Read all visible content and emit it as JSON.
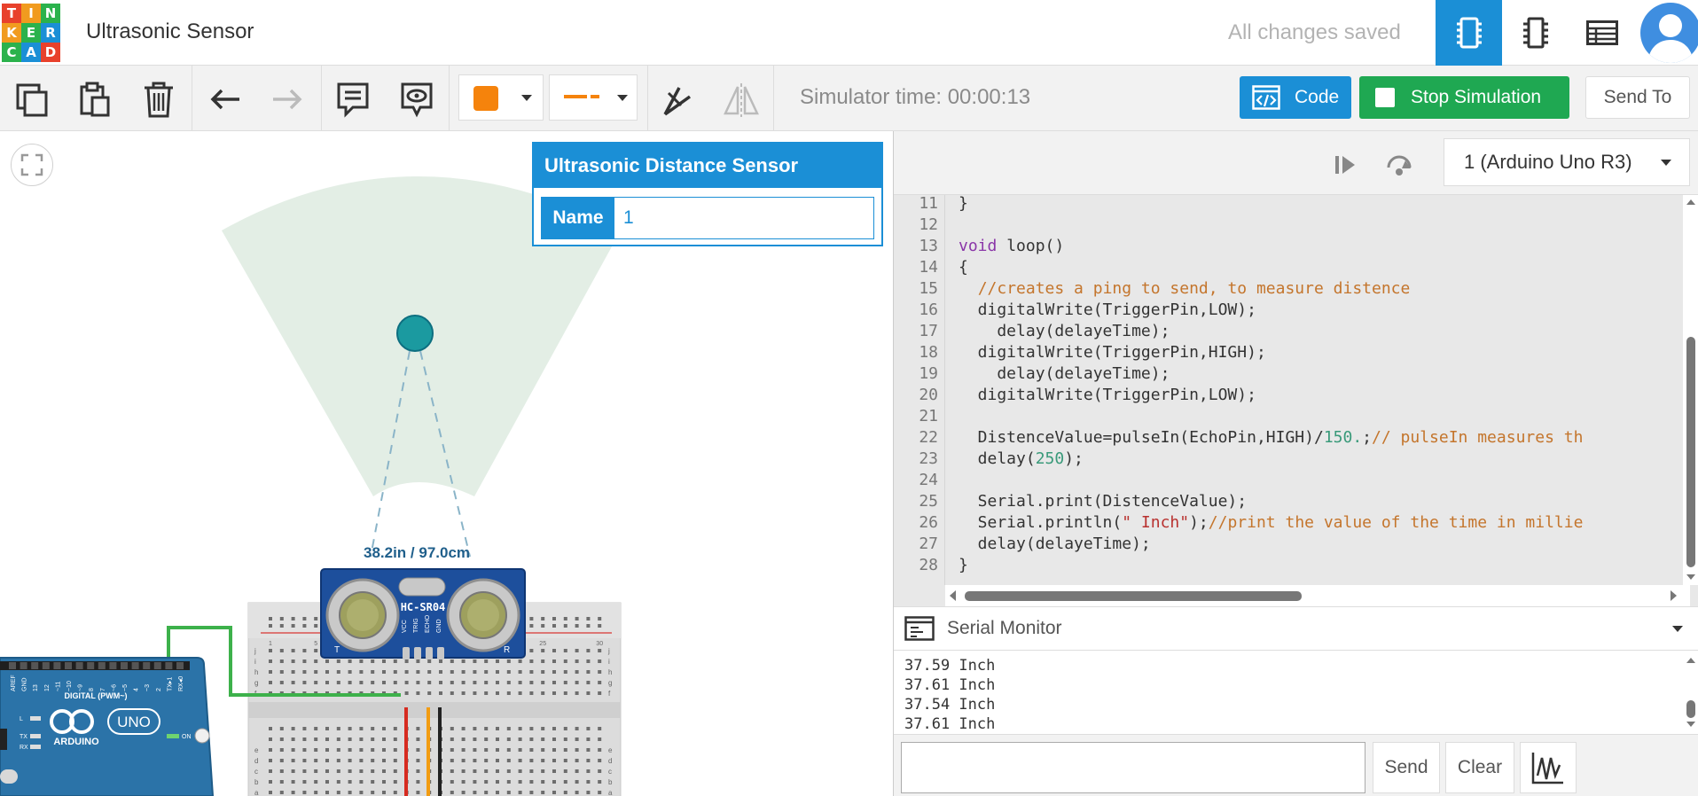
{
  "header": {
    "logo_letters": [
      "T",
      "I",
      "N",
      "K",
      "E",
      "R",
      "C",
      "A",
      "D"
    ],
    "logo_colors": [
      "#e8412c",
      "#f19b1f",
      "#2bb24c",
      "#f19b1f",
      "#2bb24c",
      "#1b8fd6",
      "#2bb24c",
      "#1b8fd6",
      "#e8412c"
    ],
    "project_title": "Ultrasonic Sensor",
    "save_status": "All changes saved",
    "views": [
      "circuit-view-icon",
      "schematic-view-icon",
      "component-list-icon"
    ],
    "active_view": "circuit-view-icon"
  },
  "toolbar": {
    "icons": [
      "copy-icon",
      "paste-icon",
      "delete-icon",
      "undo-icon",
      "redo-icon",
      "note-icon",
      "notes-visibility-icon",
      "color-picker",
      "wire-style-picker",
      "wire-tool-icon",
      "mirror-icon"
    ],
    "color_value": "#f5830c",
    "simulator_time_label": "Simulator time: 00:00:13",
    "code_label": "Code",
    "stop_label": "Stop Simulation",
    "send_to_label": "Send To"
  },
  "inspector": {
    "title": "Ultrasonic Distance Sensor",
    "name_label": "Name",
    "name_value": "1"
  },
  "canvas": {
    "distance_readout": "38.2in / 97.0cm",
    "sensor_model": "HC-SR04",
    "sensor_pins": [
      "VCC",
      "TRIG",
      "ECHO",
      "GND"
    ],
    "sensor_corner_labels": [
      "T",
      "R"
    ],
    "board_logo_text": "ARDUINO",
    "board_model": "UNO",
    "board_header_label": "DIGITAL (PWM~)",
    "board_pin_labels": [
      "AREF",
      "GND",
      "13",
      "12",
      "~11",
      "~10",
      "~9",
      "8",
      "7",
      "~6",
      "~5",
      "4",
      "~3",
      "2",
      "TX▸1",
      "RX◂0"
    ],
    "board_leds": [
      "L",
      "TX",
      "RX"
    ],
    "board_on_label": "ON",
    "breadboard_row_letters": [
      "a",
      "b",
      "c",
      "d",
      "e",
      "f",
      "g",
      "h",
      "i",
      "j"
    ],
    "breadboard_col_numbers": [
      "1",
      "5",
      "10",
      "15",
      "20",
      "25",
      "30"
    ]
  },
  "code": {
    "device": "1 (Arduino Uno R3)",
    "lines": [
      {
        "n": "11",
        "text": "}"
      },
      {
        "n": "12",
        "text": ""
      },
      {
        "n": "13",
        "kw": "void",
        "text": " loop()"
      },
      {
        "n": "14",
        "text": "{"
      },
      {
        "n": "15",
        "indent": "  ",
        "comment": "//creates a ping to send, to measure distence"
      },
      {
        "n": "16",
        "text": "  digitalWrite(TriggerPin,LOW);"
      },
      {
        "n": "17",
        "text": "    delay(delayeTime);"
      },
      {
        "n": "18",
        "text": "  digitalWrite(TriggerPin,HIGH);"
      },
      {
        "n": "19",
        "text": "    delay(delayeTime);"
      },
      {
        "n": "20",
        "text": "  digitalWrite(TriggerPin,LOW);"
      },
      {
        "n": "21",
        "text": ""
      },
      {
        "n": "22",
        "text": "  DistenceValue=pulseIn(EchoPin,HIGH)/",
        "num": "150.",
        "after": ";",
        "comment": "// pulseIn measures th"
      },
      {
        "n": "23",
        "text": "  delay(",
        "num": "250",
        "after": ");"
      },
      {
        "n": "24",
        "text": ""
      },
      {
        "n": "25",
        "text": "  Serial.print(DistenceValue);"
      },
      {
        "n": "26",
        "text": "  Serial.println(",
        "str": "\" Inch\"",
        "after": ");",
        "comment": "//print the value of the time in millie"
      },
      {
        "n": "27",
        "text": "  delay(delayeTime);"
      },
      {
        "n": "28",
        "text": "}"
      }
    ]
  },
  "serial": {
    "title": "Serial Monitor",
    "output": [
      "37.59 Inch",
      "37.61 Inch",
      "37.54 Inch",
      "37.61 Inch"
    ],
    "send_label": "Send",
    "clear_label": "Clear"
  }
}
